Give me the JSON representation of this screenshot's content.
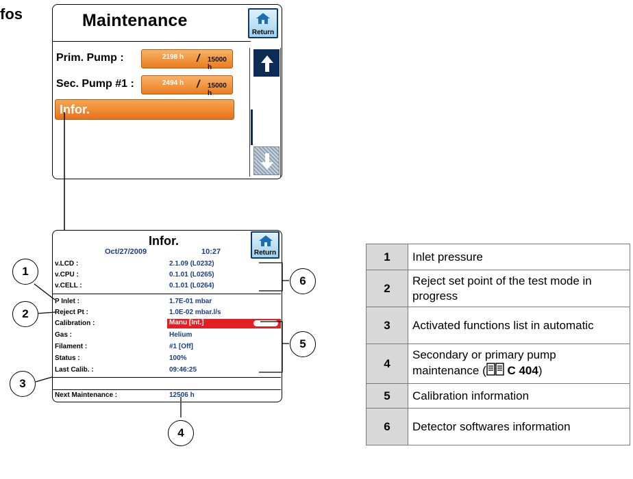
{
  "page": {
    "heading": "fos"
  },
  "screen1": {
    "title": "Maintenance",
    "return_label": "Return",
    "rows": [
      {
        "label": "Prim. Pump :",
        "hours": "2198 h",
        "limit": "15000 h"
      },
      {
        "label": "Sec. Pump #1 :",
        "hours": "2494 h",
        "limit": "15000 h"
      }
    ],
    "infor_label": "Infor."
  },
  "screen2": {
    "title": "Infor.",
    "date": "Oct/27/2009",
    "time": "10:27",
    "return_label": "Return",
    "software": [
      {
        "label": "v.LCD :",
        "value": "2.1.09  (L0232)"
      },
      {
        "label": "v.CPU :",
        "value": "0.1.01  (L0265)"
      },
      {
        "label": "v.CELL :",
        "value": "0.1.01  (L0264)"
      }
    ],
    "pressure": [
      {
        "label": "P Inlet :",
        "value": "1.7E-01 mbar"
      },
      {
        "label": "Reject Pt :",
        "value": "1.0E-02 mbar.l/s"
      }
    ],
    "calibration": [
      {
        "label": "Calibration :",
        "value": "Manu [Int.]"
      },
      {
        "label": "Gas :",
        "value": "Helium"
      },
      {
        "label": "Filament :",
        "value": "#1 [Off]"
      },
      {
        "label": "Status :",
        "value": "100%"
      },
      {
        "label": "Last Calib. :",
        "value": "09:46:25"
      }
    ],
    "maintenance": {
      "label": "Next Maintenance :",
      "value": "12506 h"
    }
  },
  "callouts": [
    "1",
    "2",
    "3",
    "4",
    "5",
    "6"
  ],
  "legend": [
    {
      "num": "1",
      "text": "Inlet pressure"
    },
    {
      "num": "2",
      "text": "Reject set point of the test mode in progress"
    },
    {
      "num": "3",
      "text": "Activated functions list in automatic"
    },
    {
      "num": "4",
      "text": "Secondary or primary pump maintenance (",
      "ref": "C 404",
      "suffix": ")"
    },
    {
      "num": "5",
      "text": "Calibration information"
    },
    {
      "num": "6",
      "text": "Detector softwares information"
    }
  ],
  "colors": {
    "orange": "#ec7d1f",
    "navy": "#0b2c55",
    "calib_red": "#e31e24",
    "value_blue": "#1a3c8c"
  }
}
